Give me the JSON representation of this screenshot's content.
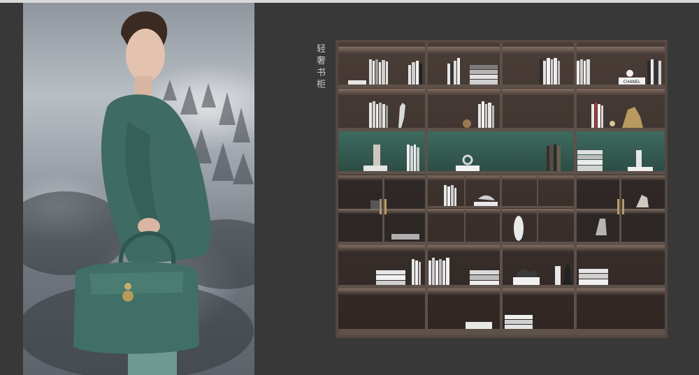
{
  "vertical_title": "轻奢书柜",
  "product_label": "CHANEL",
  "colors": {
    "background": "#383838",
    "cabinet_wood": "#3b2f2b",
    "cabinet_frame": "#544842",
    "accent_green": "#355c52",
    "handbag": "#3f6f66",
    "shirt": "#3e6b62"
  },
  "photo_subject": "model-with-green-handbag"
}
